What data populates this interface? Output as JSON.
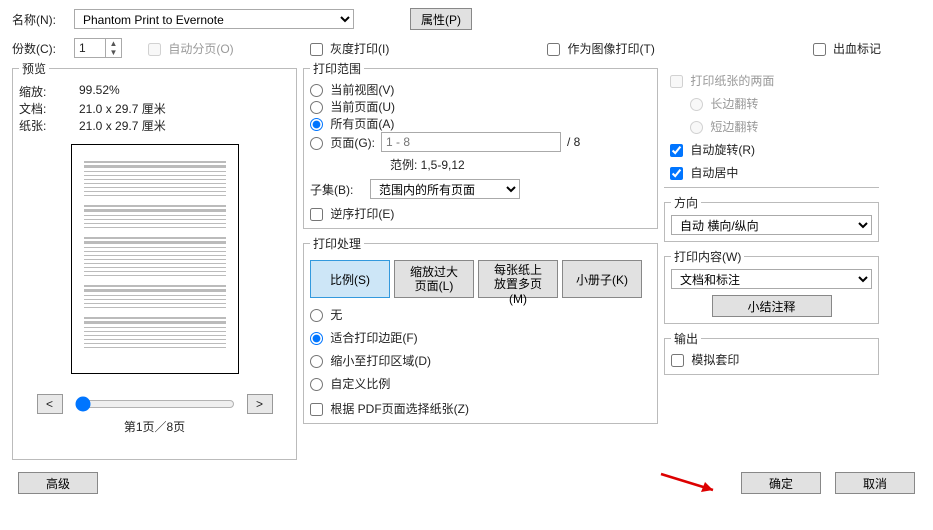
{
  "top": {
    "name_label": "名称(N):",
    "printer": "Phantom Print to Evernote",
    "properties_btn": "属性(P)",
    "copies_label": "份数(C):",
    "copies_value": "1",
    "collate": "自动分页(O)",
    "grayscale": "灰度打印(I)",
    "as_image": "作为图像打印(T)",
    "bleed": "出血标记"
  },
  "preview": {
    "legend": "预览",
    "zoom_k": "缩放:",
    "zoom_v": "99.52%",
    "doc_k": "文档:",
    "doc_v": "21.0 x 29.7 厘米",
    "paper_k": "纸张:",
    "paper_v": "21.0 x 29.7 厘米",
    "page_label": "第1页／8页"
  },
  "range": {
    "legend": "打印范围",
    "r_currentview": "当前视图(V)",
    "r_currentpage": "当前页面(U)",
    "r_all": "所有页面(A)",
    "r_pages": "页面(G):",
    "pages_placeholder": "1 - 8",
    "total": "/ 8",
    "example": "范例: 1,5-9,12",
    "subset_k": "子集(B):",
    "subset_v": "范围内的所有页面",
    "reverse": "逆序打印(E)"
  },
  "handle": {
    "legend": "打印处理",
    "tab_scale": "比例(S)",
    "tab_big_l1": "缩放过大",
    "tab_big_l2": "页面(L)",
    "tab_multi_l1": "每张纸上",
    "tab_multi_l2": "放置多页(M)",
    "tab_booklet": "小册子(K)",
    "r_none": "无",
    "r_fit": "适合打印边距(F)",
    "r_shrink": "缩小至打印区域(D)",
    "r_custom": "自定义比例",
    "choose_by_pdf": "根据 PDF页面选择纸张(Z)"
  },
  "right": {
    "duplex": "打印纸张的两面",
    "long_edge": "长边翻转",
    "short_edge": "短边翻转",
    "autorotate": "自动旋转(R)",
    "center": "自动居中",
    "orient_legend": "方向",
    "orient_value": "自动 横向/纵向",
    "what_legend": "打印内容(W)",
    "what_value": "文档和标注",
    "summarize": "小结注释",
    "output_legend": "输出",
    "simulate": "模拟套印"
  },
  "bottom": {
    "advanced": "高级",
    "ok": "确定",
    "cancel": "取消"
  }
}
